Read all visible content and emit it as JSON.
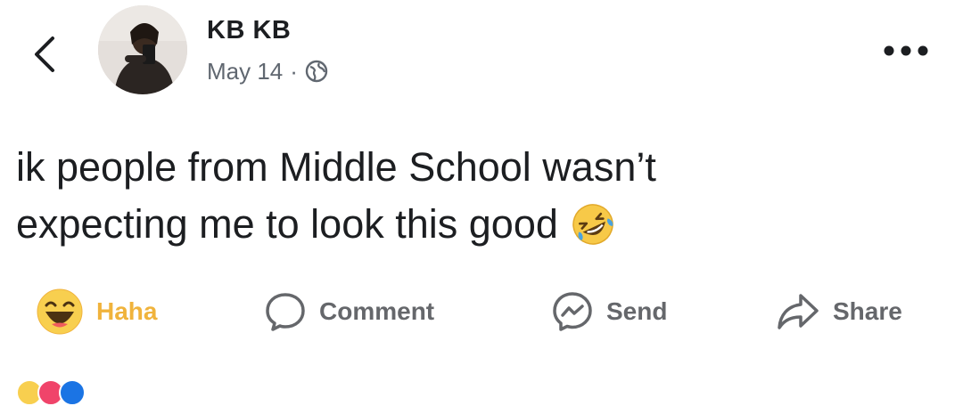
{
  "header": {
    "back_icon": "chevron-left-icon",
    "author_name": "KB KB",
    "post_date": "May 14",
    "separator": "·",
    "audience_icon": "globe-icon",
    "more_icon": "more-dots-icon"
  },
  "post": {
    "text_line1": "ik people from Middle School wasn’t",
    "text_line2": "expecting me to look this good",
    "emoji": "rolling-on-floor-laughing-emoji"
  },
  "actions": {
    "reaction_label": "Haha",
    "comment_label": "Comment",
    "send_label": "Send",
    "share_label": "Share"
  },
  "colors": {
    "haha_accent": "#f0b33c",
    "text_primary": "#1c1e21",
    "text_secondary": "#65676b"
  }
}
